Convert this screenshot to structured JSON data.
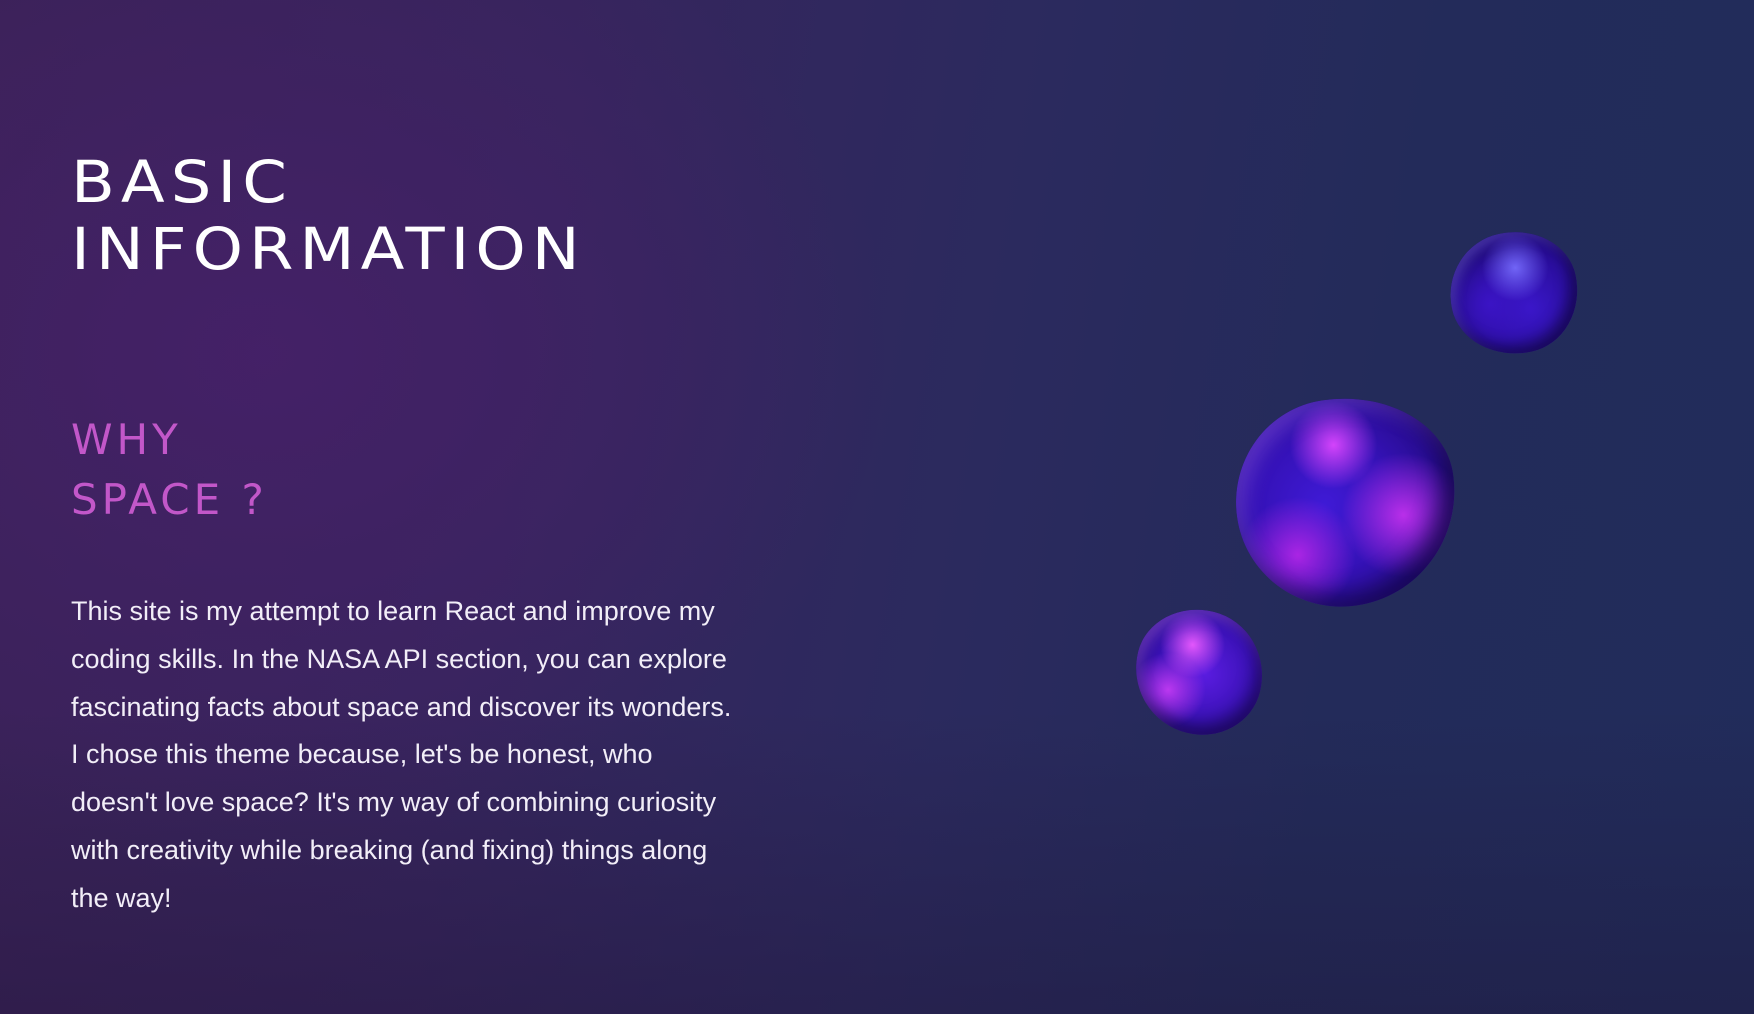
{
  "page": {
    "title_lines": [
      "BASIC",
      "INFORMATION"
    ]
  },
  "section": {
    "title_lines": [
      "WHY",
      "SPACE ?"
    ],
    "body": "This site is my attempt to learn React and improve my coding skills. In the NASA API section, you can explore fascinating facts about space and discover its wonders. I chose this theme because, let's be honest, who doesn't love space? It's my way of combining curiosity with creativity while breaking (and fixing) things along the way!"
  },
  "colors": {
    "title": "#ffffff",
    "accent": "#c257c9",
    "body_text": "#f2eef8",
    "background_left": "#3b2258",
    "background_right": "#212c5b"
  },
  "decorations": [
    "purple-blob-small-top",
    "purple-blob-large",
    "purple-blob-small-bottom"
  ]
}
